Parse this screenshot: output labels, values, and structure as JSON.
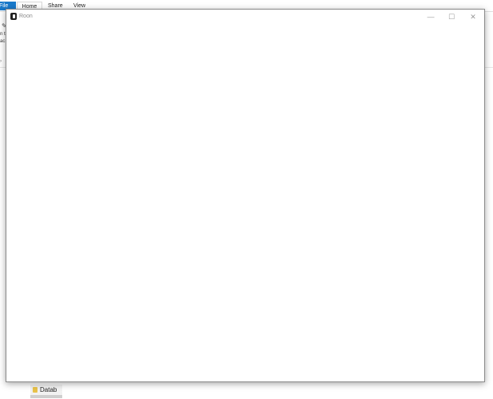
{
  "explorer": {
    "tabs": {
      "file": "File",
      "home": "Home",
      "share": "Share",
      "view": "View"
    },
    "ribbon_fragment_1": "n to",
    "ribbon_fragment_2": "ac",
    "nav_item_label": "Datab"
  },
  "roon_window": {
    "title": "Roon",
    "minimize_glyph": "—",
    "maximize_glyph": "☐",
    "close_glyph": "✕"
  }
}
